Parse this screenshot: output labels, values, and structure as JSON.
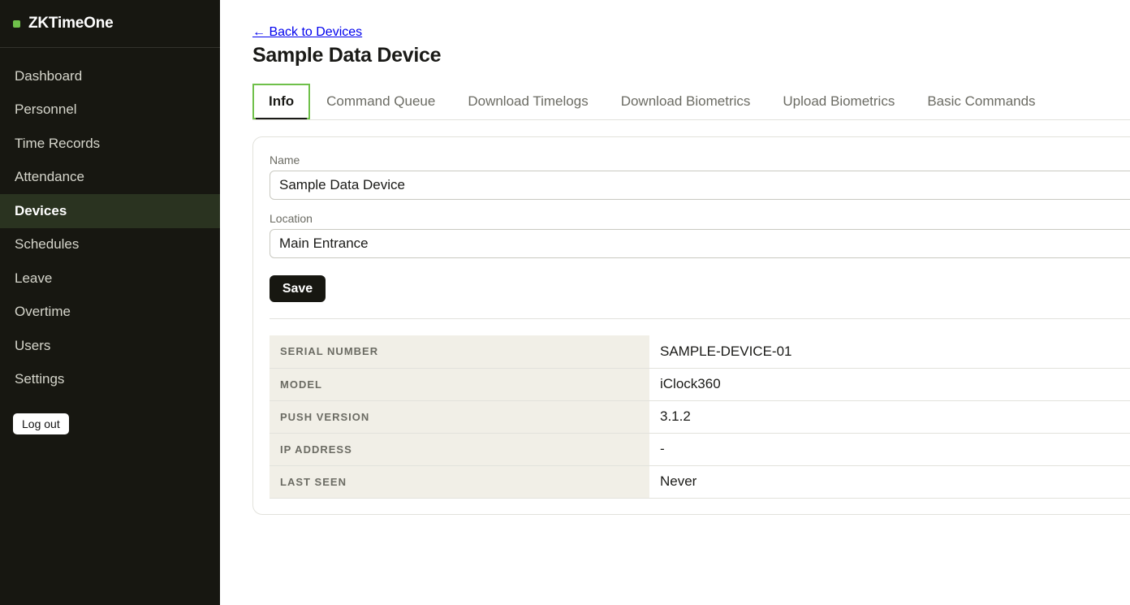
{
  "brand": {
    "name": "ZKTimeOne",
    "accent_color": "#6fc04a"
  },
  "sidebar": {
    "items": [
      {
        "label": "Dashboard",
        "active": false
      },
      {
        "label": "Personnel",
        "active": false
      },
      {
        "label": "Time Records",
        "active": false
      },
      {
        "label": "Attendance",
        "active": false
      },
      {
        "label": "Devices",
        "active": true
      },
      {
        "label": "Schedules",
        "active": false
      },
      {
        "label": "Leave",
        "active": false
      },
      {
        "label": "Overtime",
        "active": false
      },
      {
        "label": "Users",
        "active": false
      },
      {
        "label": "Settings",
        "active": false
      }
    ],
    "logout_label": "Log out"
  },
  "header": {
    "back_link": "← Back to Devices",
    "title": "Sample Data Device"
  },
  "tabs": [
    {
      "label": "Info",
      "active": true
    },
    {
      "label": "Command Queue",
      "active": false
    },
    {
      "label": "Download Timelogs",
      "active": false
    },
    {
      "label": "Download Biometrics",
      "active": false
    },
    {
      "label": "Upload Biometrics",
      "active": false
    },
    {
      "label": "Basic Commands",
      "active": false
    }
  ],
  "form": {
    "name_label": "Name",
    "name_value": "Sample Data Device",
    "location_label": "Location",
    "location_value": "Main Entrance",
    "save_label": "Save"
  },
  "details": [
    {
      "key": "SERIAL NUMBER",
      "value": "SAMPLE-DEVICE-01"
    },
    {
      "key": "MODEL",
      "value": "iClock360"
    },
    {
      "key": "PUSH VERSION",
      "value": "3.1.2"
    },
    {
      "key": "IP ADDRESS",
      "value": "-"
    },
    {
      "key": "LAST SEEN",
      "value": "Never"
    }
  ]
}
